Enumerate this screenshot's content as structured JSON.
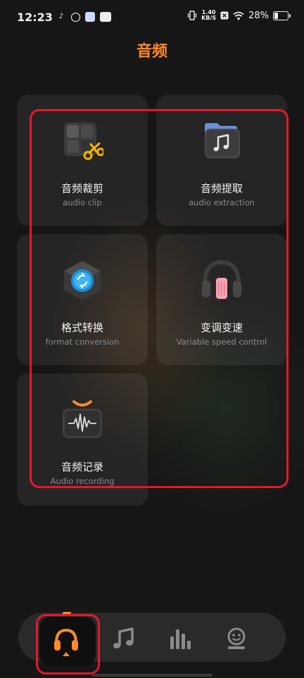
{
  "status_bar": {
    "time": "12:23",
    "net_speed_value": "1.40",
    "net_speed_unit": "KB/S",
    "battery": "28%",
    "icons": [
      "tiktok-icon",
      "app-icon",
      "app-icon",
      "app-icon",
      "vibrate-icon",
      "wifi-icon",
      "battery-icon"
    ]
  },
  "page": {
    "title": "音频"
  },
  "cards": [
    {
      "id": "clip",
      "title": "音频裁剪",
      "subtitle": "audio clip",
      "icon": "audio-clip-icon"
    },
    {
      "id": "extract",
      "title": "音频提取",
      "subtitle": "audio extraction",
      "icon": "music-note-folder-icon"
    },
    {
      "id": "format",
      "title": "格式转换",
      "subtitle": "format conversion",
      "icon": "format-convert-icon"
    },
    {
      "id": "speed",
      "title": "变调变速",
      "subtitle": "Variable speed control",
      "icon": "headphones-icon"
    },
    {
      "id": "record",
      "title": "音频记录",
      "subtitle": "Audio recording",
      "icon": "waveform-icon"
    }
  ],
  "bottom_nav": {
    "items": [
      {
        "name": "headphones-icon",
        "active": true
      },
      {
        "name": "music-note-icon",
        "active": false
      },
      {
        "name": "bar-chart-icon",
        "active": false
      },
      {
        "name": "face-icon",
        "active": false
      }
    ]
  },
  "colors": {
    "accent": "#ff8a2a",
    "highlight": "#e5172a"
  }
}
